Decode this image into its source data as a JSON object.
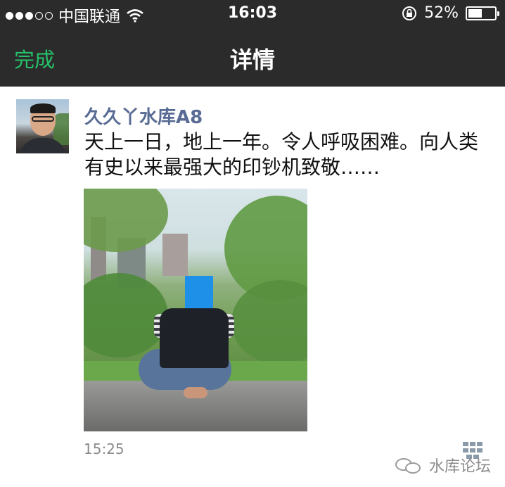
{
  "status_bar": {
    "carrier": "中国联通",
    "time": "16:03",
    "battery_percent_text": "52%",
    "battery_level": 0.52,
    "signal_dots_filled": 3,
    "signal_dots_total": 5
  },
  "nav": {
    "done_label": "完成",
    "title": "详情"
  },
  "post": {
    "author": "久久丫水库A8",
    "text": "天上一日，地上一年。令人呼吸困难。向人类有史以来最强大的印钞机致敬……",
    "time": "15:25"
  },
  "watermark": {
    "text": "水库论坛"
  },
  "colors": {
    "nav_background": "#2b2b2b",
    "done_green": "#27c06a",
    "author_blue": "#586b94",
    "face_mask_blue": "#1e90e8"
  },
  "icons": {
    "wifi": "wifi-icon",
    "rotation_lock": "rotation-lock-icon",
    "battery": "battery-icon",
    "wechat": "wechat-icon"
  }
}
